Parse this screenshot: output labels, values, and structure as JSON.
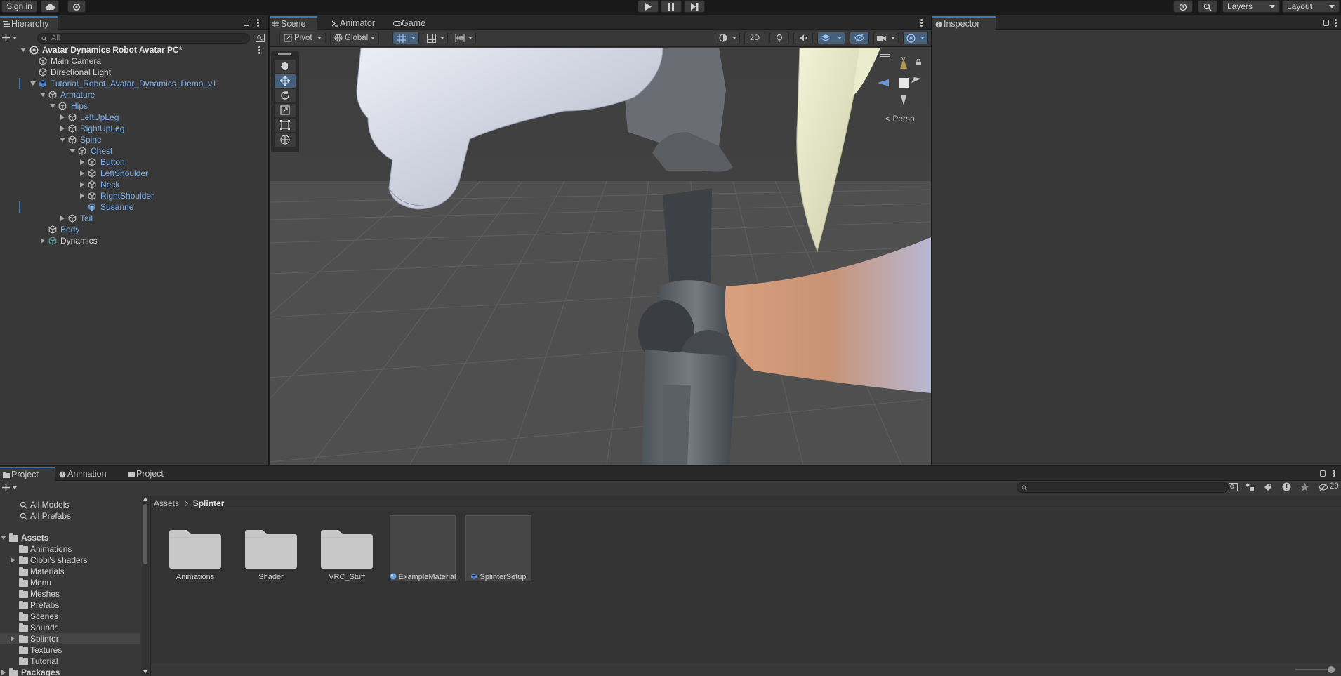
{
  "topbar": {
    "sign_in": "Sign in",
    "layers": "Layers",
    "layout": "Layout"
  },
  "hierarchy": {
    "tab": "Hierarchy",
    "search_placeholder": "All",
    "scene_name": "Avatar Dynamics Robot Avatar PC*",
    "items": [
      {
        "label": "Main Camera",
        "color": "#d2d2d2"
      },
      {
        "label": "Directional Light",
        "color": "#d2d2d2"
      },
      {
        "label": "Tutorial_Robot_Avatar_Dynamics_Demo_v1",
        "color": "#7cb0ee"
      },
      {
        "label": "Armature",
        "color": "#7cb0ee"
      },
      {
        "label": "Hips",
        "color": "#7cb0ee"
      },
      {
        "label": "LeftUpLeg",
        "color": "#7cb0ee"
      },
      {
        "label": "RightUpLeg",
        "color": "#7cb0ee"
      },
      {
        "label": "Spine",
        "color": "#7cb0ee"
      },
      {
        "label": "Chest",
        "color": "#7cb0ee"
      },
      {
        "label": "Button",
        "color": "#7cb0ee"
      },
      {
        "label": "LeftShoulder",
        "color": "#7cb0ee"
      },
      {
        "label": "Neck",
        "color": "#7cb0ee"
      },
      {
        "label": "RightShoulder",
        "color": "#7cb0ee"
      },
      {
        "label": "Susanne",
        "color": "#7cb0ee"
      },
      {
        "label": "Tail",
        "color": "#7cb0ee"
      },
      {
        "label": "Body",
        "color": "#7cb0ee"
      },
      {
        "label": "Dynamics",
        "color": "#d2d2d2"
      }
    ]
  },
  "scene": {
    "tabs": [
      "Scene",
      "Animator",
      "Game"
    ],
    "pivot": "Pivot",
    "global": "Global",
    "mode_2d": "2D",
    "gizmo_y": "y",
    "persp": "Persp"
  },
  "inspector": {
    "tab": "Inspector"
  },
  "project": {
    "tabs": [
      "Project",
      "Animation",
      "Project"
    ],
    "search_placeholder": "",
    "hidden_count": "29",
    "favorites": [
      "All Models",
      "All Prefabs"
    ],
    "assets_root": "Assets",
    "folders": [
      "Animations",
      "Cibbi's shaders",
      "Materials",
      "Menu",
      "Meshes",
      "Prefabs",
      "Scenes",
      "Sounds",
      "Splinter",
      "Textures",
      "Tutorial"
    ],
    "packages": "Packages",
    "breadcrumb": [
      "Assets",
      "Splinter"
    ],
    "grid_items": [
      {
        "label": "Animations",
        "kind": "folder"
      },
      {
        "label": "Shader",
        "kind": "folder"
      },
      {
        "label": "VRC_Stuff",
        "kind": "folder"
      },
      {
        "label": "ExampleMaterial",
        "kind": "material"
      },
      {
        "label": "SplinterSetup",
        "kind": "prefab"
      }
    ]
  },
  "colors": {
    "selection_blue": "#3a79bb",
    "prefab_blue": "#7cb0ee",
    "panel_bg": "#383838",
    "scene_bg": "#4a4a4a"
  }
}
